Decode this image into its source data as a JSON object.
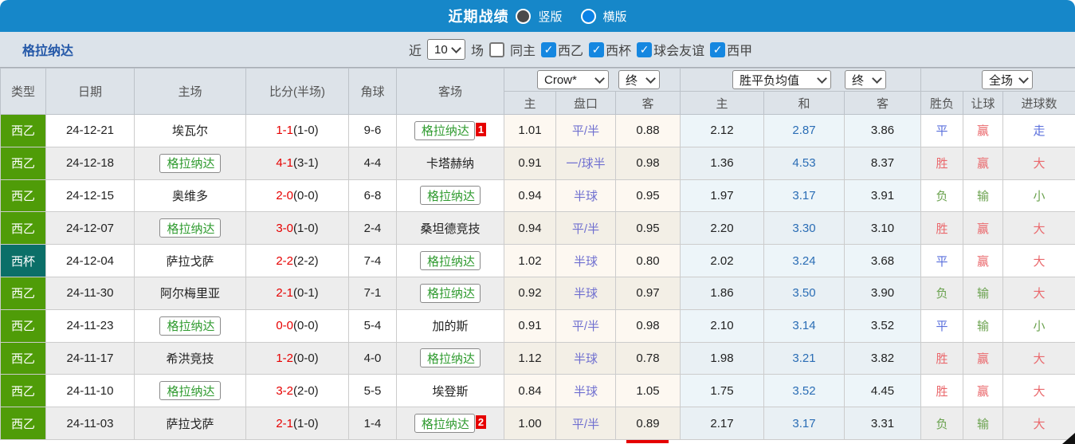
{
  "topbar": {
    "title": "近期战绩",
    "radio_vertical": "竖版",
    "radio_horizontal": "横版",
    "selected_layout": "横版"
  },
  "filter": {
    "team": "格拉纳达",
    "near_label": "近",
    "count_value": "10",
    "games_label": "场",
    "same_home_label": "同主",
    "same_home_checked": false,
    "leagues": [
      "西乙",
      "西杯",
      "球会友谊",
      "西甲"
    ],
    "leagues_checked": [
      true,
      true,
      true,
      true
    ]
  },
  "table": {
    "selects": {
      "bookmaker": "Crow*",
      "final1": "终",
      "avg": "胜平负均值",
      "final2": "终",
      "scope": "全场"
    },
    "headers": {
      "type": "类型",
      "date": "日期",
      "home": "主场",
      "score": "比分(半场)",
      "corners": "角球",
      "away": "客场",
      "odds_home": "主",
      "handicap": "盘口",
      "odds_away": "客",
      "avg_home": "主",
      "avg_draw": "和",
      "avg_away": "客",
      "wdl": "胜负",
      "handicap_result": "让球",
      "goals": "进球数"
    },
    "rows": [
      {
        "type": "西乙",
        "type_color": "green",
        "date": "24-12-21",
        "home": "埃瓦尔",
        "home_is_team": false,
        "score_ft": "1-1",
        "score_ht": "1-0",
        "corners": "9-6",
        "away": "格拉纳达",
        "away_is_team": true,
        "away_badge": "1",
        "odds": [
          "1.01",
          "平/半",
          "0.88"
        ],
        "avg": [
          "2.12",
          "2.87",
          "3.86"
        ],
        "wdl": "平",
        "wdl_c": "blue",
        "rang": "赢",
        "rang_c": "red",
        "goals": "走",
        "goals_c": "blue"
      },
      {
        "type": "西乙",
        "type_color": "green",
        "date": "24-12-18",
        "home": "格拉纳达",
        "home_is_team": true,
        "score_ft": "4-1",
        "score_ht": "3-1",
        "corners": "4-4",
        "away": "卡塔赫纳",
        "away_is_team": false,
        "away_badge": "",
        "odds": [
          "0.91",
          "一/球半",
          "0.98"
        ],
        "avg": [
          "1.36",
          "4.53",
          "8.37"
        ],
        "wdl": "胜",
        "wdl_c": "red",
        "rang": "赢",
        "rang_c": "red",
        "goals": "大",
        "goals_c": "red"
      },
      {
        "type": "西乙",
        "type_color": "green",
        "date": "24-12-15",
        "home": "奥维多",
        "home_is_team": false,
        "score_ft": "2-0",
        "score_ht": "0-0",
        "corners": "6-8",
        "away": "格拉纳达",
        "away_is_team": true,
        "away_badge": "",
        "odds": [
          "0.94",
          "半球",
          "0.95"
        ],
        "avg": [
          "1.97",
          "3.17",
          "3.91"
        ],
        "wdl": "负",
        "wdl_c": "green",
        "rang": "输",
        "rang_c": "green",
        "goals": "小",
        "goals_c": "green"
      },
      {
        "type": "西乙",
        "type_color": "green",
        "date": "24-12-07",
        "home": "格拉纳达",
        "home_is_team": true,
        "score_ft": "3-0",
        "score_ht": "1-0",
        "corners": "2-4",
        "away": "桑坦德竞技",
        "away_is_team": false,
        "away_badge": "",
        "odds": [
          "0.94",
          "平/半",
          "0.95"
        ],
        "avg": [
          "2.20",
          "3.30",
          "3.10"
        ],
        "wdl": "胜",
        "wdl_c": "red",
        "rang": "赢",
        "rang_c": "red",
        "goals": "大",
        "goals_c": "red"
      },
      {
        "type": "西杯",
        "type_color": "teal",
        "date": "24-12-04",
        "home": "萨拉戈萨",
        "home_is_team": false,
        "score_ft": "2-2",
        "score_ht": "2-2",
        "corners": "7-4",
        "away": "格拉纳达",
        "away_is_team": true,
        "away_badge": "",
        "odds": [
          "1.02",
          "半球",
          "0.80"
        ],
        "avg": [
          "2.02",
          "3.24",
          "3.68"
        ],
        "wdl": "平",
        "wdl_c": "blue",
        "rang": "赢",
        "rang_c": "red",
        "goals": "大",
        "goals_c": "red"
      },
      {
        "type": "西乙",
        "type_color": "green",
        "date": "24-11-30",
        "home": "阿尔梅里亚",
        "home_is_team": false,
        "score_ft": "2-1",
        "score_ht": "0-1",
        "corners": "7-1",
        "away": "格拉纳达",
        "away_is_team": true,
        "away_badge": "",
        "odds": [
          "0.92",
          "半球",
          "0.97"
        ],
        "avg": [
          "1.86",
          "3.50",
          "3.90"
        ],
        "wdl": "负",
        "wdl_c": "green",
        "rang": "输",
        "rang_c": "green",
        "goals": "大",
        "goals_c": "red"
      },
      {
        "type": "西乙",
        "type_color": "green",
        "date": "24-11-23",
        "home": "格拉纳达",
        "home_is_team": true,
        "score_ft": "0-0",
        "score_ht": "0-0",
        "corners": "5-4",
        "away": "加的斯",
        "away_is_team": false,
        "away_badge": "",
        "odds": [
          "0.91",
          "平/半",
          "0.98"
        ],
        "avg": [
          "2.10",
          "3.14",
          "3.52"
        ],
        "wdl": "平",
        "wdl_c": "blue",
        "rang": "输",
        "rang_c": "green",
        "goals": "小",
        "goals_c": "green"
      },
      {
        "type": "西乙",
        "type_color": "green",
        "date": "24-11-17",
        "home": "希洪竞技",
        "home_is_team": false,
        "score_ft": "1-2",
        "score_ht": "0-0",
        "corners": "4-0",
        "away": "格拉纳达",
        "away_is_team": true,
        "away_badge": "",
        "odds": [
          "1.12",
          "半球",
          "0.78"
        ],
        "avg": [
          "1.98",
          "3.21",
          "3.82"
        ],
        "wdl": "胜",
        "wdl_c": "red",
        "rang": "赢",
        "rang_c": "red",
        "goals": "大",
        "goals_c": "red"
      },
      {
        "type": "西乙",
        "type_color": "green",
        "date": "24-11-10",
        "home": "格拉纳达",
        "home_is_team": true,
        "score_ft": "3-2",
        "score_ht": "2-0",
        "corners": "5-5",
        "away": "埃登斯",
        "away_is_team": false,
        "away_badge": "",
        "odds": [
          "0.84",
          "半球",
          "1.05"
        ],
        "avg": [
          "1.75",
          "3.52",
          "4.45"
        ],
        "wdl": "胜",
        "wdl_c": "red",
        "rang": "赢",
        "rang_c": "red",
        "goals": "大",
        "goals_c": "red"
      },
      {
        "type": "西乙",
        "type_color": "green",
        "date": "24-11-03",
        "home": "萨拉戈萨",
        "home_is_team": false,
        "score_ft": "2-1",
        "score_ht": "1-0",
        "corners": "1-4",
        "away": "格拉纳达",
        "away_is_team": true,
        "away_badge": "2",
        "odds": [
          "1.00",
          "平/半",
          "0.89"
        ],
        "avg": [
          "2.17",
          "3.17",
          "3.31"
        ],
        "wdl": "负",
        "wdl_c": "green",
        "rang": "输",
        "rang_c": "green",
        "goals": "大",
        "goals_c": "red"
      }
    ]
  },
  "colors": {
    "topbar_blue": "#1687c9",
    "league_green": "#4f9c08",
    "league_teal": "#0b6f68",
    "team_green": "#2f9b2f",
    "score_red": "#e60000",
    "handicap_purple": "#7070d0",
    "avg_blue": "#2a6db5",
    "result_red": "#ea686c",
    "result_blue": "#5a6fdc",
    "result_green": "#6ba24f",
    "badge_red": "#e60000",
    "checkbox_blue": "#1587e0"
  }
}
